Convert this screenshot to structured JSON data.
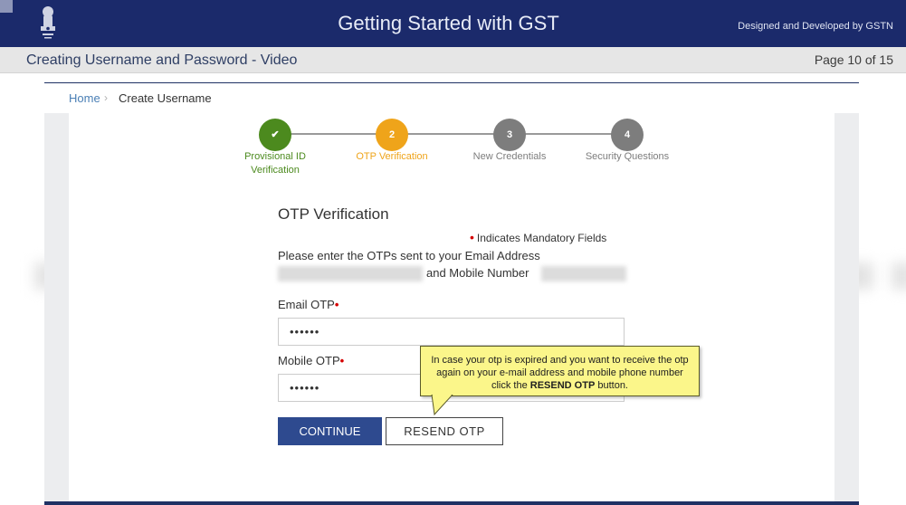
{
  "header": {
    "title": "Getting Started with GST",
    "credit": "Designed and Developed by GSTN",
    "emblem_icon": "national-emblem-icon",
    "color": "#1b2a6b"
  },
  "video_bar": {
    "title": "Creating Username and Password - Video",
    "page_indicator": "Page 10 of 15"
  },
  "breadcrumb": {
    "home": "Home",
    "separator": "›",
    "current": "Create Username"
  },
  "stepper": {
    "steps": [
      {
        "marker": "✔",
        "label_line1": "Provisional ID",
        "label_line2": "Verification",
        "state": "completed",
        "color": "#4c8a1e"
      },
      {
        "marker": "2",
        "label_line1": "OTP Verification",
        "label_line2": "",
        "state": "active",
        "color": "#efa41a"
      },
      {
        "marker": "3",
        "label_line1": "New Credentials",
        "label_line2": "",
        "state": "pending",
        "color": "#7d7d7d"
      },
      {
        "marker": "4",
        "label_line1": "Security Questions",
        "label_line2": "",
        "state": "pending",
        "color": "#7d7d7d"
      }
    ]
  },
  "form": {
    "title": "OTP Verification",
    "mandatory_note": "Indicates Mandatory Fields",
    "instruction_line1": "Please enter the OTPs sent to your Email Address",
    "instruction_line2": "and Mobile Number",
    "email_label": "Email OTP",
    "email_value": "••••••",
    "mobile_label": "Mobile OTP",
    "mobile_value": "••••••",
    "required_marker": "•",
    "continue_label": "CONTINUE",
    "resend_label": "RESEND OTP"
  },
  "callout": {
    "text_before": "In case your otp is expired and you want to receive the otp again on your e-mail address and mobile phone number click the ",
    "text_bold": "RESEND OTP",
    "text_after": " button."
  }
}
